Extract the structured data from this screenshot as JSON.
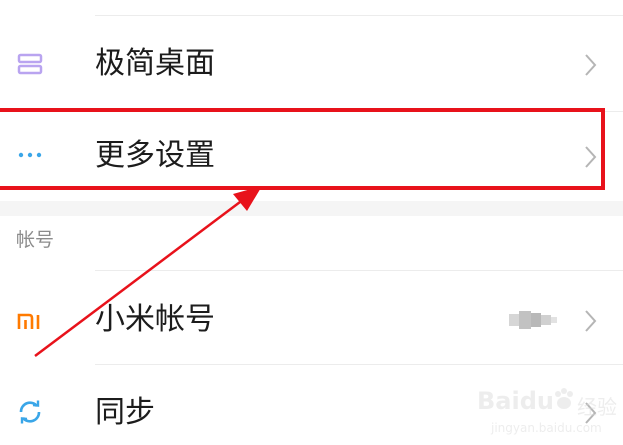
{
  "settings_list": {
    "rows": [
      {
        "label": "极简桌面",
        "icon": "minimal-desktop-icon"
      },
      {
        "label": "更多设置",
        "icon": "more-dots-icon"
      },
      {
        "label": "小米帐号",
        "icon": "mi-logo-icon",
        "value": "blurred"
      },
      {
        "label": "同步",
        "icon": "sync-icon"
      }
    ],
    "section_header": "帐号"
  },
  "annotation": {
    "highlight_color": "#e8121b",
    "arrow_color": "#e8121b"
  },
  "watermark": {
    "brand": "Baidu",
    "chinese": "经验",
    "url": "jingyan.baidu.com"
  },
  "colors": {
    "minimal_desktop_icon": "#b9a4f0",
    "more_dots_icon": "#3aa6e8",
    "mi_logo_icon": "#ff7a00",
    "sync_icon": "#3aa6e8"
  }
}
